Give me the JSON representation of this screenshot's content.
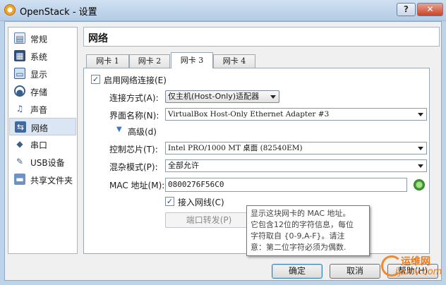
{
  "window": {
    "title": "OpenStack - 设置",
    "help_label": "?",
    "close_label": "✕"
  },
  "sidebar": {
    "items": [
      {
        "label": "常规",
        "icon": "general-icon"
      },
      {
        "label": "系统",
        "icon": "system-icon"
      },
      {
        "label": "显示",
        "icon": "display-icon"
      },
      {
        "label": "存储",
        "icon": "storage-icon"
      },
      {
        "label": "声音",
        "icon": "audio-icon"
      },
      {
        "label": "网络",
        "icon": "network-icon",
        "selected": true
      },
      {
        "label": "串口",
        "icon": "serial-port-icon"
      },
      {
        "label": "USB设备",
        "icon": "usb-icon"
      },
      {
        "label": "共享文件夹",
        "icon": "shared-folder-icon"
      }
    ]
  },
  "main": {
    "title": "网络",
    "tabs": [
      {
        "label": "网卡 1"
      },
      {
        "label": "网卡 2"
      },
      {
        "label": "网卡 3",
        "active": true
      },
      {
        "label": "网卡 4"
      }
    ]
  },
  "adapter": {
    "enable_label": "启用网络连接(E)",
    "enable_checked": true,
    "attached_label": "连接方式(A):",
    "attached_value": "仅主机(Host-Only)适配器",
    "name_label": "界面名称(N):",
    "name_value": "VirtualBox Host-Only Ethernet Adapter #3",
    "advanced_label": "高级(d)",
    "type_label": "控制芯片(T):",
    "type_value": "Intel PRO/1000 MT 桌面 (82540EM)",
    "promisc_label": "混杂模式(P):",
    "promisc_value": "全部允许",
    "mac_label": "MAC 地址(M):",
    "mac_value": "0800276F56C0",
    "cable_label": "接入网线(C)",
    "cable_checked": true,
    "port_forward_label": "端口转发(P)"
  },
  "tooltip": {
    "lines": [
      "显示这块网卡的 MAC 地址。",
      "它包含12位的字符信息，每位",
      "字符取自 {0-9,A-F}。请注",
      "意：第二位字符必须为偶数."
    ]
  },
  "buttons": {
    "ok": "确定",
    "cancel": "取消",
    "help": "帮助(H)"
  },
  "watermark": {
    "cn": "运维网",
    "en": "iyunv.com"
  }
}
